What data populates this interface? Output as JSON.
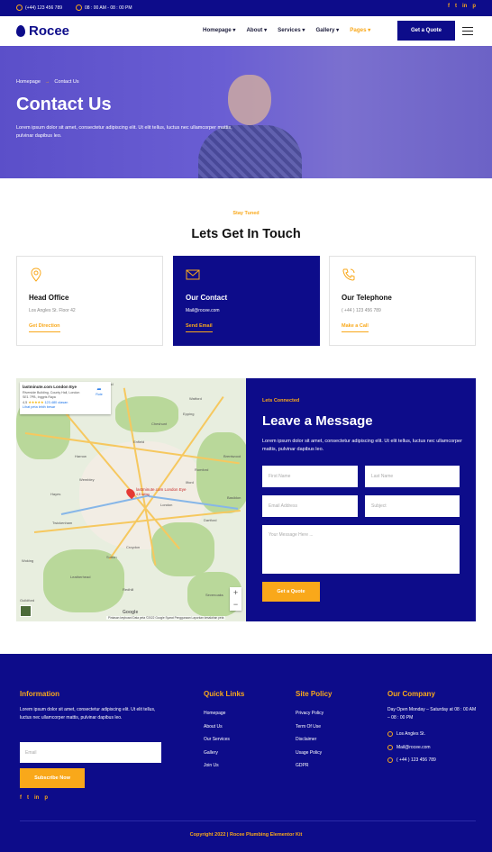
{
  "topbar": {
    "phone": "(+44) 123 456 789",
    "hours": "08 : 00 AM - 08 : 00 PM",
    "social": [
      "f",
      "t",
      "in",
      "p"
    ]
  },
  "header": {
    "brand": "Rocee",
    "nav": [
      "Homepage",
      "About",
      "Services",
      "Gallery",
      "Pages"
    ],
    "active_nav": "Pages",
    "quote_label": "Get a Quote"
  },
  "hero": {
    "breadcrumb": [
      "Homepage",
      "Contact Us"
    ],
    "title": "Contact Us",
    "description": "Lorem ipsum dolor sit amet, consectetur adipiscing elit. Ut elit tellus, luctus nec ullamcorper mattis, pulvinar dapibus leo."
  },
  "contact": {
    "kicker": "Stay Tuned",
    "title": "Lets Get In Touch",
    "cards": [
      {
        "icon": "map-pin-icon",
        "title": "Head Office",
        "text": "Los Angles St. Floor 42",
        "link": "Get Direction"
      },
      {
        "icon": "envelope-icon",
        "title": "Our Contact",
        "text": "Mail@rocee.com",
        "link": "Send Email"
      },
      {
        "icon": "phone-icon",
        "title": "Our Telephone",
        "text": "( +44 ) 123 456 789",
        "link": "Make a Call"
      }
    ]
  },
  "map": {
    "place_name": "lastminute.com London Eye",
    "address": "Riverside Building, County Hall, London SE1 7PB, Inggris Raya",
    "rating": "4,5",
    "stars": "★★★★★",
    "reviews": "123.480 ulasan",
    "larger_map": "Lihat peta lebih besar",
    "route": "Rute",
    "pin_label": "lastminute.com London Eye",
    "pin_sub": "4,5 rating",
    "attribution": "Pintasan keyboard   Data peta ©2022 Google   Syarat Penggunaan   Laporkan kesalahan peta",
    "logo": "Google",
    "places": [
      "Watford",
      "Cheshunt",
      "Enfield",
      "Harrow",
      "Wembley",
      "Romford",
      "Ilford",
      "Hayes",
      "London",
      "Dartford",
      "Croydon",
      "Sutton",
      "Leatherhead",
      "Twickenham",
      "Guildford",
      "Sevenoaks",
      "Brentwood",
      "Basildon",
      "Woking",
      "Redhill",
      "Epping",
      "Hatfield"
    ]
  },
  "form": {
    "kicker": "Lets Connected",
    "title": "Leave a Message",
    "description": "Lorem ipsum dolor sit amet, consectetur adipiscing elit. Ut elit tellus, luctus nec ullamcorper mattis, pulvinar dapibus leo.",
    "first_name": "First Name",
    "last_name": "Last Name",
    "email": "Email Address",
    "subject": "Subject",
    "message": "Your Message Here ...",
    "submit": "Get a Quote"
  },
  "footer": {
    "info": {
      "title": "Information",
      "text": "Lorem ipsum dolor sit amet, consectetur adipiscing elit. Ut elit tellus, luctus nec ullamcorper mattis, pulvinar dapibus leo.",
      "email_placeholder": "Email",
      "subscribe": "Subscribe Now"
    },
    "quick_links": {
      "title": "Quick Links",
      "items": [
        "Homepage",
        "About Us",
        "Our Services",
        "Gallery",
        "Join Us"
      ]
    },
    "site_policy": {
      "title": "Site Policy",
      "items": [
        "Privacy Policy",
        "Term Of Use",
        "Disclaimer",
        "Usage Policy",
        "GDPR"
      ]
    },
    "company": {
      "title": "Our Company",
      "hours": "Day Open Monday – Saturday at 08 : 00 AM – 08 : 00 PM",
      "address": "Los Angles St.",
      "email": "Mail@rocee.com",
      "phone": "( +44 ) 123 456 789"
    },
    "copyright": "Copyright 2022 | Rocee Plumbing Elementor Kit"
  },
  "colors": {
    "brand": "#0d0c8a",
    "accent": "#f9a81a",
    "hero": "#6a5ed3"
  }
}
